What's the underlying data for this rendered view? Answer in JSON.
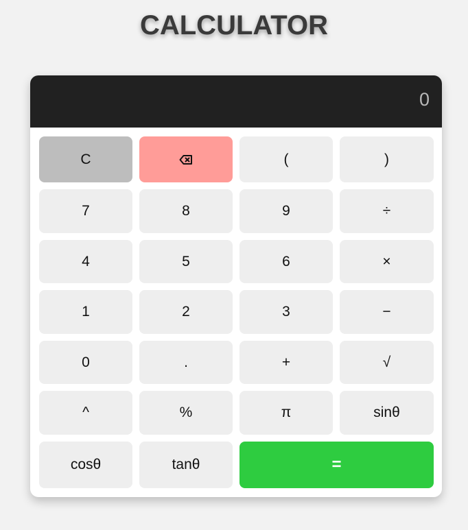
{
  "app": {
    "title": "CALCULATOR"
  },
  "display": {
    "value": "0"
  },
  "colors": {
    "background": "#f2f2f2",
    "display_bg": "#212121",
    "clear_button": "#bdbdbd",
    "backspace_button": "#ff9c98",
    "equals_button": "#2ecc40",
    "default_button": "#eeeeee"
  },
  "buttons": {
    "clear": "C",
    "backspace_icon": "backspace-icon",
    "open_paren": "(",
    "close_paren": ")",
    "seven": "7",
    "eight": "8",
    "nine": "9",
    "divide": "÷",
    "four": "4",
    "five": "5",
    "six": "6",
    "multiply": "×",
    "one": "1",
    "two": "2",
    "three": "3",
    "subtract": "−",
    "zero": "0",
    "decimal": ".",
    "add": "+",
    "sqrt": "√",
    "power": "^",
    "percent": "%",
    "pi": "π",
    "sin": "sinθ",
    "cos": "cosθ",
    "tan": "tanθ",
    "equals": "="
  }
}
